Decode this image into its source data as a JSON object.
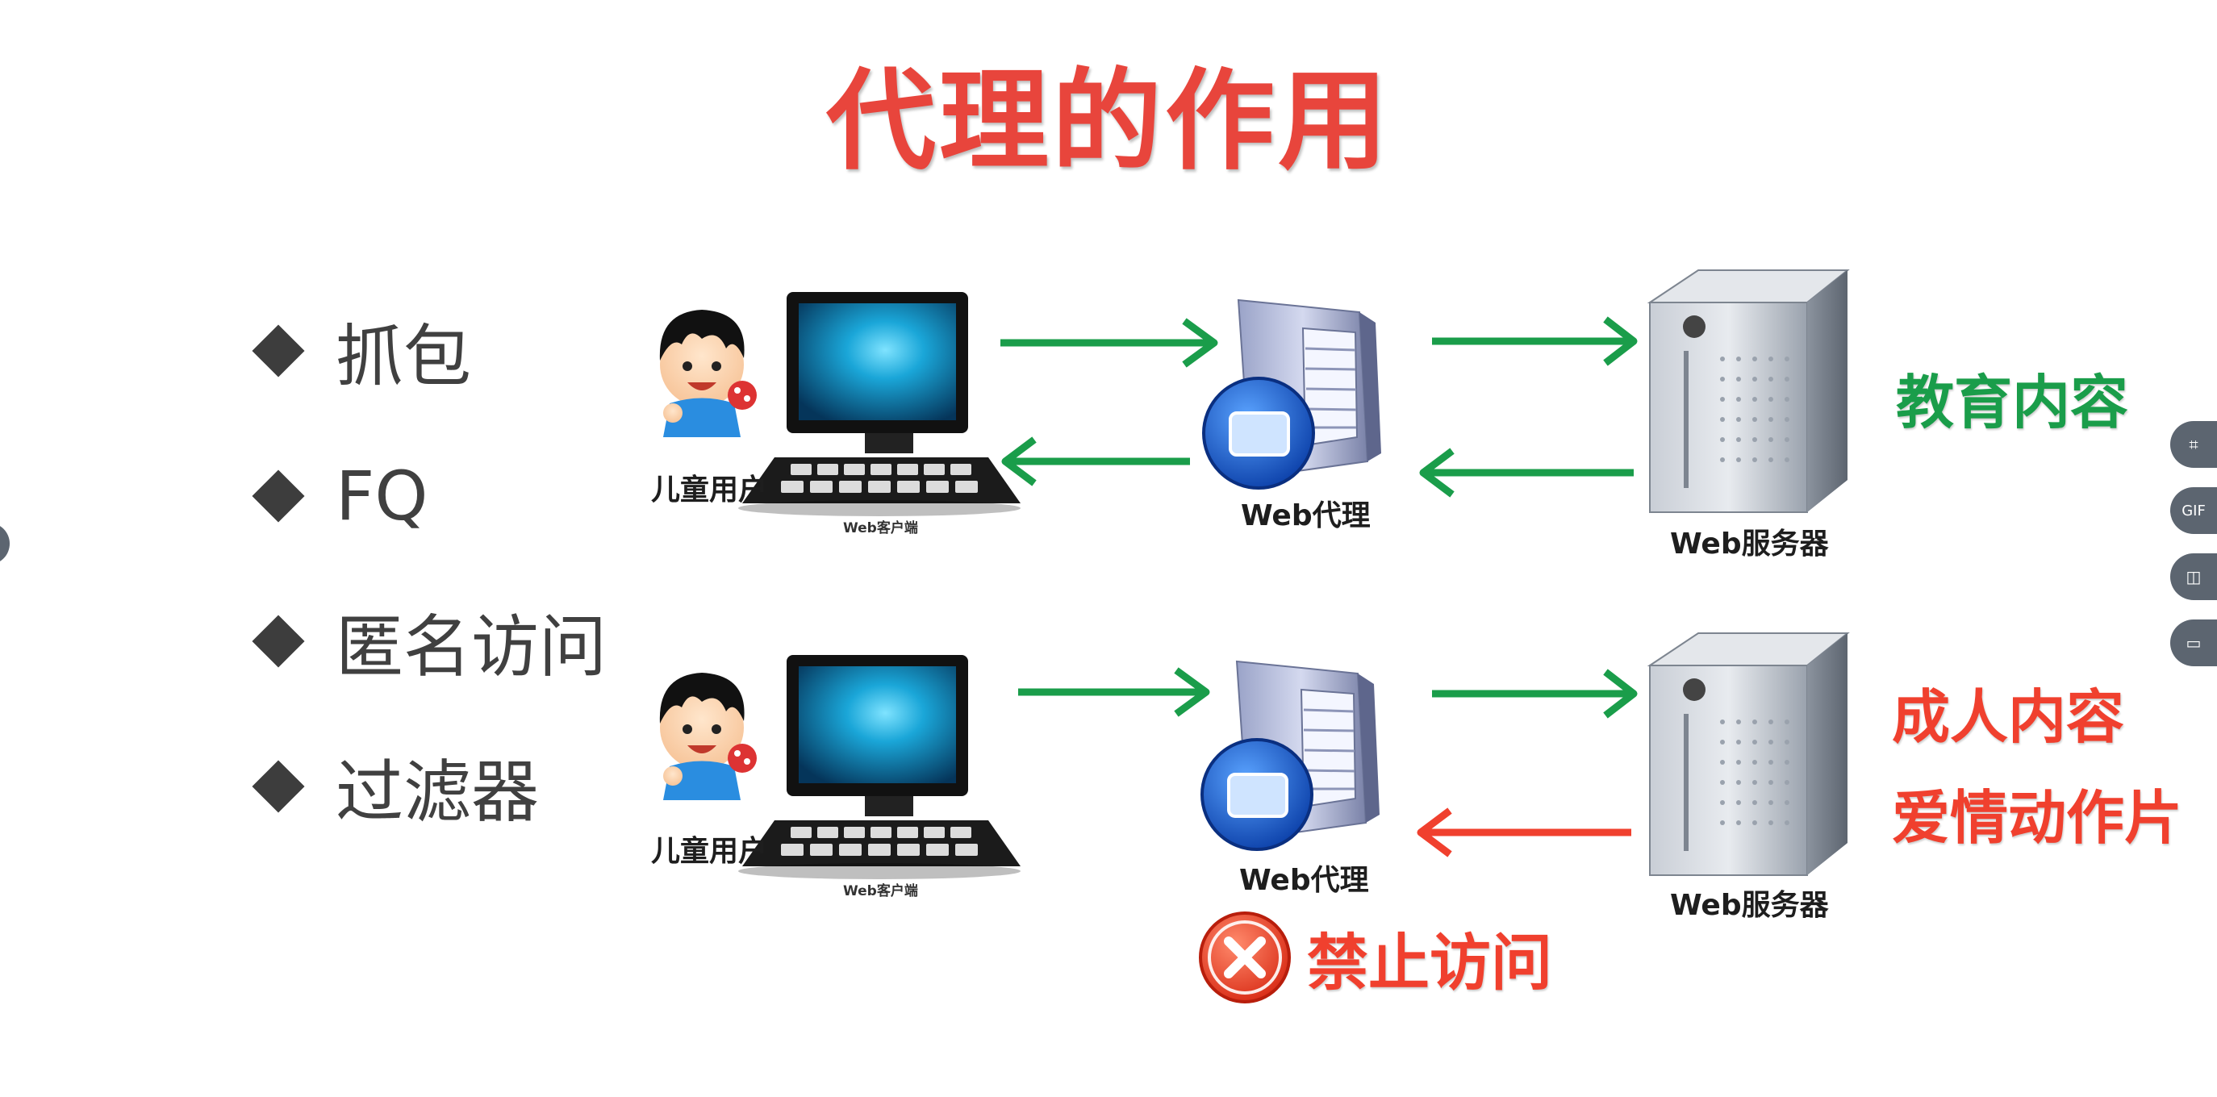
{
  "slide": {
    "title": "代理的作用",
    "bullets": [
      "抓包",
      "FQ",
      "匿名访问",
      "过滤器"
    ]
  },
  "diagram": {
    "top_row": {
      "user_label": "儿童用户",
      "client_label": "Web客户端",
      "proxy_label": "Web代理",
      "server_label": "Web服务器",
      "content_lines": [
        "教育内容"
      ],
      "return_arrow_color": "#1a9d4a"
    },
    "bottom_row": {
      "user_label": "儿童用户",
      "client_label": "Web客户端",
      "proxy_label": "Web代理",
      "server_label": "Web服务器",
      "content_lines": [
        "成人内容",
        "爱情动作片"
      ],
      "return_arrow_color": "#f0402e",
      "blocked_text": "禁止访问"
    }
  },
  "toolbar": {
    "buttons": [
      {
        "name": "crop-icon",
        "label": "⌗"
      },
      {
        "name": "gif-icon",
        "label": "GIF"
      },
      {
        "name": "video-camera-icon",
        "label": "◫"
      },
      {
        "name": "screen-record-icon",
        "label": "▭"
      }
    ]
  },
  "colors": {
    "title": "#e8453c",
    "green": "#1a9d4a",
    "red": "#f0402e"
  }
}
